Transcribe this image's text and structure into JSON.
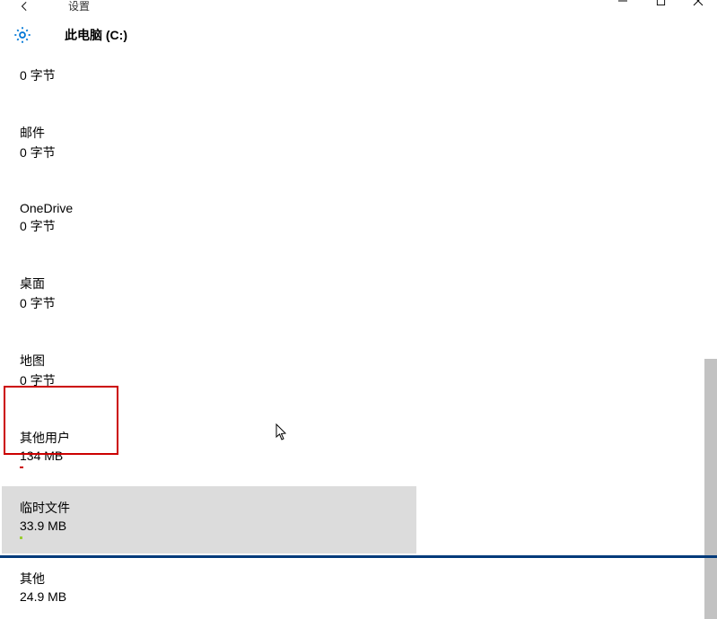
{
  "window": {
    "back_visible": true,
    "title_partial": "设置",
    "drive_title": "此电脑 (C:)"
  },
  "storage_items": [
    {
      "label": "",
      "size": "0 字节",
      "bar_color": ""
    },
    {
      "label": "邮件",
      "size": "0 字节",
      "bar_color": ""
    },
    {
      "label": "OneDrive",
      "size": "0 字节",
      "bar_color": ""
    },
    {
      "label": "桌面",
      "size": "0 字节",
      "bar_color": ""
    },
    {
      "label": "地图",
      "size": "0 字节",
      "bar_color": ""
    },
    {
      "label": "其他用户",
      "size": "134 MB",
      "bar_color": "#cc0000"
    },
    {
      "label": "临时文件",
      "size": "33.9 MB",
      "bar_color": "#88cc00",
      "selected": true
    },
    {
      "label": "其他",
      "size": "24.9 MB",
      "bar_color": ""
    }
  ]
}
